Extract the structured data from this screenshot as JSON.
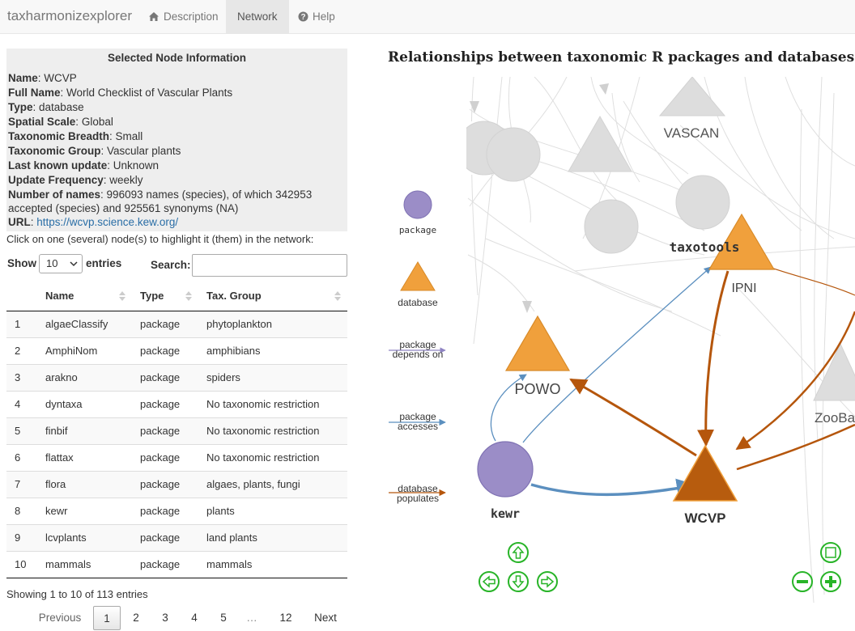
{
  "nav": {
    "brand": "taxharmonizexplorer",
    "tabs": [
      {
        "label": "Description",
        "icon": "home-icon"
      },
      {
        "label": "Network",
        "active": true
      },
      {
        "label": "Help",
        "icon": "question-circle-icon"
      }
    ]
  },
  "info": {
    "title": "Selected Node Information",
    "fields": [
      {
        "key": "Name",
        "value": "WCVP"
      },
      {
        "key": "Full Name",
        "value": "World Checklist of Vascular Plants"
      },
      {
        "key": "Type",
        "value": "database"
      },
      {
        "key": "Spatial Scale",
        "value": "Global"
      },
      {
        "key": "Taxonomic Breadth",
        "value": "Small"
      },
      {
        "key": "Taxonomic Group",
        "value": "Vascular plants"
      },
      {
        "key": "Last known update",
        "value": "Unknown"
      },
      {
        "key": "Update Frequency",
        "value": "weekly"
      },
      {
        "key": "Number of names",
        "value": "996093 names (species), of which 342953 accepted (species) and 925561 synonyms (NA)"
      },
      {
        "key": "URL",
        "value": "https://wcvp.science.kew.org/"
      }
    ]
  },
  "hint": "Click on one (several) node(s) to highlight it (them) in the network:",
  "table_controls": {
    "show_label": "Show",
    "length_value": "10",
    "entries_label": "entries",
    "search_label": "Search:",
    "search_value": ""
  },
  "table": {
    "columns": [
      "",
      "Name",
      "Type",
      "Tax. Group"
    ],
    "rows": [
      [
        "1",
        "algaeClassify",
        "package",
        "phytoplankton"
      ],
      [
        "2",
        "AmphiNom",
        "package",
        "amphibians"
      ],
      [
        "3",
        "arakno",
        "package",
        "spiders"
      ],
      [
        "4",
        "dyntaxa",
        "package",
        "No taxonomic restriction"
      ],
      [
        "5",
        "finbif",
        "package",
        "No taxonomic restriction"
      ],
      [
        "6",
        "flattax",
        "package",
        "No taxonomic restriction"
      ],
      [
        "7",
        "flora",
        "package",
        "algaes, plants, fungi"
      ],
      [
        "8",
        "kewr",
        "package",
        "plants"
      ],
      [
        "9",
        "lcvplants",
        "package",
        "land plants"
      ],
      [
        "10",
        "mammals",
        "package",
        "mammals"
      ]
    ]
  },
  "table_info": "Showing 1 to 10 of 113 entries",
  "pagination": {
    "previous": "Previous",
    "pages": [
      "1",
      "2",
      "3",
      "4",
      "5",
      "…",
      "12"
    ],
    "current": "1",
    "next": "Next"
  },
  "network": {
    "title": "Relationships between taxonomic R packages and databases",
    "legend": {
      "package": "package",
      "database": "database",
      "depends_line1": "package",
      "depends_line2": "depends on",
      "accesses_line1": "package",
      "accesses_line2": "accesses",
      "populates_line1": "database",
      "populates_line2": "populates"
    },
    "nodes": {
      "vascan": "VASCAN",
      "taxotools": "taxotools",
      "ipni": "IPNI",
      "powo": "POWO",
      "kewr": "kewr",
      "wcvp": "WCVP",
      "zooba": "ZooBa"
    },
    "colors": {
      "package": "#9b8dc7",
      "database": "#f0a03c",
      "selected_database": "#b75c0e",
      "accesses_edge": "#5b8fbf",
      "populates_edge": "#b5560c",
      "faded": "#dcdcdc",
      "nav_button": "#28b428"
    }
  }
}
